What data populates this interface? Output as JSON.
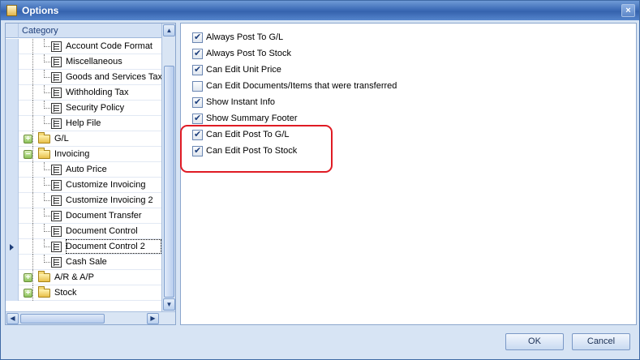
{
  "window": {
    "title": "Options",
    "close_glyph": "×"
  },
  "tree": {
    "header": "Category",
    "rows": [
      {
        "label": "Account Code Format",
        "type": "item"
      },
      {
        "label": "Miscellaneous",
        "type": "item"
      },
      {
        "label": "Goods and Services Tax",
        "type": "item"
      },
      {
        "label": "Withholding Tax",
        "type": "item"
      },
      {
        "label": "Security Policy",
        "type": "item"
      },
      {
        "label": "Help File",
        "type": "item"
      },
      {
        "label": "G/L",
        "type": "folder",
        "expander": "+"
      },
      {
        "label": "Invoicing",
        "type": "folder",
        "expander": "−"
      },
      {
        "label": "Auto Price",
        "type": "item"
      },
      {
        "label": "Customize Invoicing",
        "type": "item"
      },
      {
        "label": "Customize Invoicing 2",
        "type": "item"
      },
      {
        "label": "Document Transfer",
        "type": "item"
      },
      {
        "label": "Document Control",
        "type": "item"
      },
      {
        "label": "Document Control 2",
        "type": "item",
        "selected": true
      },
      {
        "label": "Cash Sale",
        "type": "item"
      },
      {
        "label": "A/R & A/P",
        "type": "folder",
        "expander": "+"
      },
      {
        "label": "Stock",
        "type": "folder",
        "expander": "+"
      }
    ],
    "scroll_up_glyph": "▲",
    "scroll_down_glyph": "▼",
    "scroll_left_glyph": "◀",
    "scroll_right_glyph": "▶"
  },
  "options": [
    {
      "label": "Always Post To G/L",
      "checked": true
    },
    {
      "label": "Always Post To Stock",
      "checked": true
    },
    {
      "label": "Can Edit Unit Price",
      "checked": true
    },
    {
      "label": "Can Edit Documents/Items that were transferred",
      "checked": false
    },
    {
      "label": "Show Instant Info",
      "checked": true
    },
    {
      "label": "Show Summary Footer",
      "checked": true
    },
    {
      "label": "Can Edit Post To G/L",
      "checked": true
    },
    {
      "label": "Can Edit Post To Stock",
      "checked": true
    }
  ],
  "buttons": {
    "ok": "OK",
    "cancel": "Cancel"
  },
  "colors": {
    "highlight": "#e01b24",
    "title_bar": "#3e6db7",
    "frame": "#d7e4f4"
  }
}
